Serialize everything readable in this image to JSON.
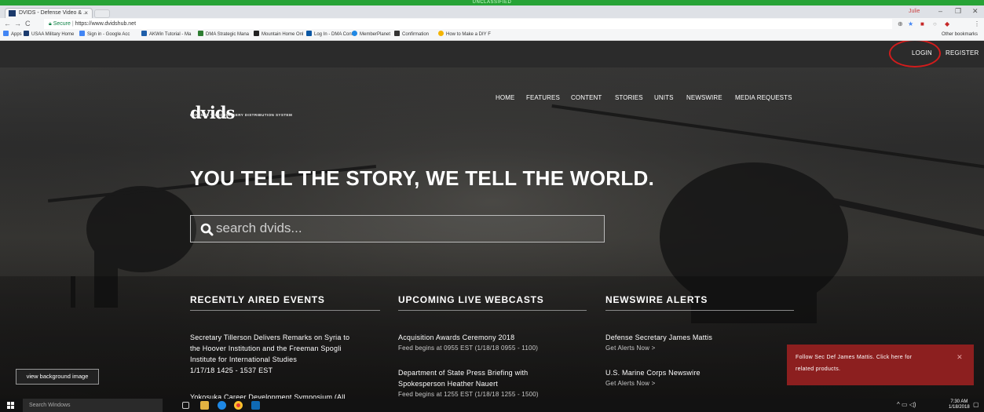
{
  "classification_banner": "UNCLASSIFIED",
  "browser": {
    "tab_title": "DVIDS - Defense Video & ...",
    "profile_name": "Julie",
    "secure_label": "Secure",
    "url": "https://www.dvidshub.net",
    "bookmarks": [
      {
        "label": "Apps",
        "color": "#4285f4"
      },
      {
        "label": "USAA Military Home",
        "color": "#1b3b6f"
      },
      {
        "label": "Sign in - Google Acc",
        "color": "#4285f4"
      },
      {
        "label": "AKWin Tutorial - Ma",
        "color": "#1f5faa"
      },
      {
        "label": "DMA Strategic Mana",
        "color": "#2e7d32"
      },
      {
        "label": "Mountain Home Onl",
        "color": "#222222"
      },
      {
        "label": "Log In - DMA Confla",
        "color": "#0a57a4"
      },
      {
        "label": "MemberPlanet",
        "color": "#1e88e5"
      },
      {
        "label": "Confirmation",
        "color": "#333333"
      },
      {
        "label": "How to Make a DIY F",
        "color": "#f4b400"
      }
    ],
    "other_bookmarks": "Other bookmarks"
  },
  "site": {
    "login_label": "LOGIN",
    "register_label": "REGISTER",
    "logo_text": "dvids",
    "tagline": "DEFENSE VIDEO IMAGERY DISTRIBUTION SYSTEM",
    "nav": [
      "HOME",
      "FEATURES",
      "CONTENT",
      "STORIES",
      "UNITS",
      "NEWSWIRE",
      "MEDIA REQUESTS"
    ],
    "headline": "YOU TELL THE STORY, WE TELL THE WORLD.",
    "search_placeholder": "search dvids...",
    "columns": {
      "recent": {
        "heading": "RECENTLY AIRED EVENTS",
        "items": [
          {
            "lines": [
              "Secretary Tillerson Delivers Remarks on Syria to",
              "the Hoover Institution and the Freeman Spogli",
              "Institute for International Studies"
            ],
            "meta": "1/17/18 1425 - 1537 EST"
          },
          {
            "lines": [
              "Yokosuka Career Development Symposium (All"
            ],
            "meta": ""
          }
        ]
      },
      "upcoming": {
        "heading": "UPCOMING LIVE WEBCASTS",
        "items": [
          {
            "lines": [
              "Acquisition Awards Ceremony 2018"
            ],
            "meta": "Feed begins at 0955 EST  (1/18/18 0955 - 1100)"
          },
          {
            "lines": [
              "Department of State Press Briefing with",
              "Spokesperson Heather Nauert"
            ],
            "meta": "Feed begins at 1255 EST  (1/18/18 1255 - 1500)"
          }
        ]
      },
      "newswire": {
        "heading": "NEWSWIRE ALERTS",
        "items": [
          {
            "title": "Defense Secretary James Mattis",
            "link": "Get Alerts Now  >"
          },
          {
            "title": "U.S. Marine Corps Newswire",
            "link": "Get Alerts Now  >"
          }
        ]
      }
    },
    "view_background": "view background image",
    "popup": {
      "line1": "Follow Sec Def James Mattis. Click here for",
      "line2": "related products.",
      "close": "✕"
    }
  },
  "taskbar": {
    "search_placeholder": "Search Windows",
    "time": "7:30 AM",
    "date": "1/18/2018"
  },
  "colors": {
    "classification_green": "#27a336",
    "annotation_red": "#d11c1c",
    "popup_red": "#8c1f1f"
  }
}
